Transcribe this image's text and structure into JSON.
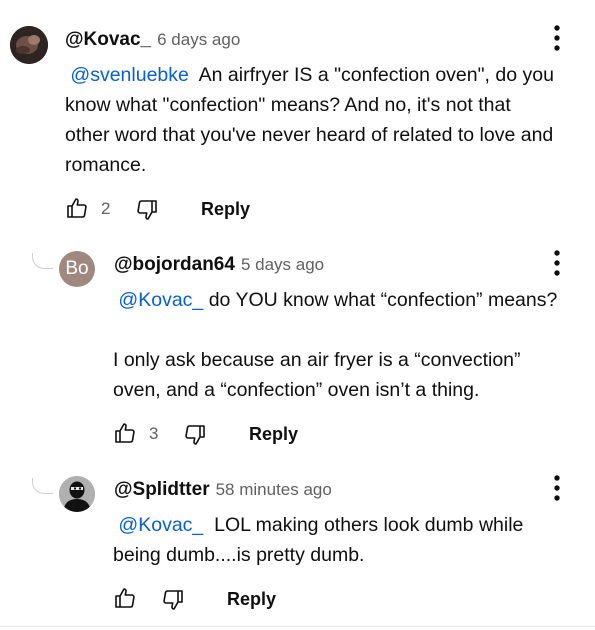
{
  "comments": [
    {
      "handle": "@Kovac_",
      "time": "6 days ago",
      "mention": "@svenluebke",
      "text_line1": "An airfryer IS a \"confection oven\", do you",
      "text_line2": "know what \"confection\" means? And no, it's not that",
      "text_line3": "other word that you've never heard of related to love and",
      "text_line4": "romance.",
      "likes": "2",
      "reply_label": "Reply",
      "avatar": "photo-avatar"
    },
    {
      "handle": "@bojordan64",
      "time": "5 days ago",
      "mention": "@Kovac_",
      "text_line1": "do YOU know what “confection” means?",
      "text_line2": "I only ask because an air fryer is a “convection”",
      "text_line3": "oven, and a “confection” oven isn’t a thing.",
      "likes": "3",
      "reply_label": "Reply",
      "avatar_initials": "Bo",
      "avatar_color": "#a1887f"
    },
    {
      "handle": "@Splidtter",
      "time": "58 minutes ago",
      "mention": "@Kovac_",
      "text_line1": "LOL making others look dumb while",
      "text_line2": "being dumb....is pretty dumb.",
      "reply_label": "Reply",
      "avatar": "masked-figure-avatar"
    }
  ],
  "icons": {
    "like": "thumbs-up-icon",
    "dislike": "thumbs-down-icon",
    "menu": "more-vert-icon"
  },
  "colors": {
    "mention": "#065fd4",
    "text": "#0f0f0f",
    "secondary": "#606060"
  }
}
